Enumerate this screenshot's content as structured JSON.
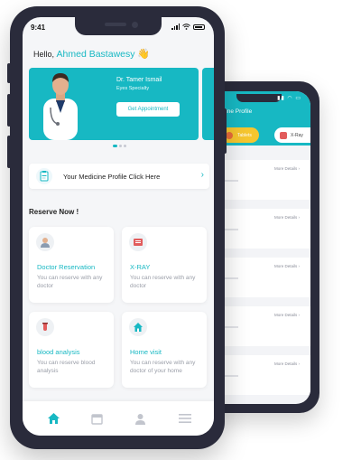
{
  "front": {
    "status": {
      "time": "9:41"
    },
    "greeting": {
      "prefix": "Hello,",
      "name": "Ahmed Bastawesy",
      "emoji": "👋"
    },
    "banner": {
      "doctor_name": "Dr. Tamer Ismail",
      "specialty": "Eyes Specialty",
      "button_label": "Get Appointment",
      "pages": 3,
      "active_page": 1
    },
    "medicine_profile": {
      "label": "Your Medicine Profile Click Here",
      "arrow": "›"
    },
    "reserve": {
      "title": "Reserve Now !",
      "cards": [
        {
          "icon": "doctor-icon",
          "title": "Doctor Reservation",
          "desc": "You can reserve with any doctor"
        },
        {
          "icon": "xray-icon",
          "title": "X-RAY",
          "desc": "You can reserve with any doctor"
        },
        {
          "icon": "blood-test-icon",
          "title": "blood analysis",
          "desc": "You can reserve blood analysis"
        },
        {
          "icon": "home-icon",
          "title": "Home visit",
          "desc": "You can reserve with any doctor of your home"
        }
      ]
    },
    "tabs": [
      {
        "icon": "home-icon",
        "active": true
      },
      {
        "icon": "calendar-icon",
        "active": false
      },
      {
        "icon": "user-icon",
        "active": false
      },
      {
        "icon": "menu-icon",
        "active": false
      }
    ]
  },
  "back": {
    "title": "dicine Profile",
    "tabs": [
      {
        "label": "Tablets"
      },
      {
        "label": "X-Ray"
      }
    ],
    "cards": [
      {
        "more": "More Details ›"
      },
      {
        "more": "More Details ›"
      },
      {
        "more": "More Details ›"
      },
      {
        "more": "More Details ›"
      },
      {
        "more": "More Details ›"
      }
    ]
  },
  "colors": {
    "accent": "#17b8c3",
    "frame": "#2a2b3b",
    "yellow": "#f6c62f"
  }
}
